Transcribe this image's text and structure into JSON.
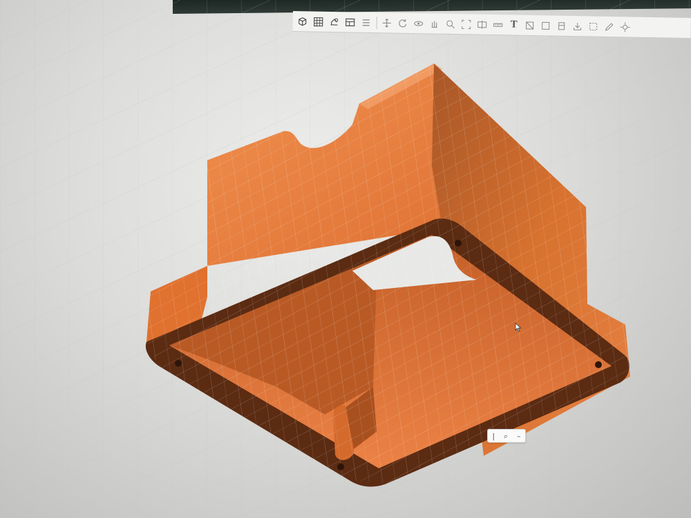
{
  "toolbar": {
    "tools": [
      {
        "id": "view-cube",
        "icon": "cube-icon"
      },
      {
        "id": "grid",
        "icon": "grid-icon"
      },
      {
        "id": "display-settings",
        "icon": "display-settings-icon"
      },
      {
        "id": "layout",
        "icon": "layout-icon"
      },
      {
        "id": "menu",
        "icon": "menu-icon"
      },
      {
        "id": "move",
        "icon": "move-icon"
      },
      {
        "id": "rotate",
        "icon": "rotate-icon"
      },
      {
        "id": "orbit",
        "icon": "orbit-icon"
      },
      {
        "id": "pan",
        "icon": "pan-icon"
      },
      {
        "id": "zoom",
        "icon": "zoom-icon"
      },
      {
        "id": "fit",
        "icon": "fit-icon"
      },
      {
        "id": "section",
        "icon": "section-icon"
      },
      {
        "id": "measure",
        "icon": "measure-icon"
      },
      {
        "id": "text",
        "icon": "text-icon",
        "label": "T"
      },
      {
        "id": "sketch",
        "icon": "sketch-icon"
      },
      {
        "id": "construct",
        "icon": "construct-icon"
      },
      {
        "id": "inspect",
        "icon": "inspect-icon"
      },
      {
        "id": "insert",
        "icon": "insert-icon"
      },
      {
        "id": "select",
        "icon": "select-icon"
      },
      {
        "id": "pencil",
        "icon": "pencil-icon"
      },
      {
        "id": "settings",
        "icon": "settings-icon"
      }
    ]
  },
  "view_control": {
    "left_label": "|",
    "center_label": "⌕",
    "right_label": "–"
  },
  "colors": {
    "model": "#e2712e",
    "model_light": "#ef8a49",
    "model_dark": "#6e3518",
    "background": "#e4e4e2",
    "grid_line": "#ffffff"
  }
}
